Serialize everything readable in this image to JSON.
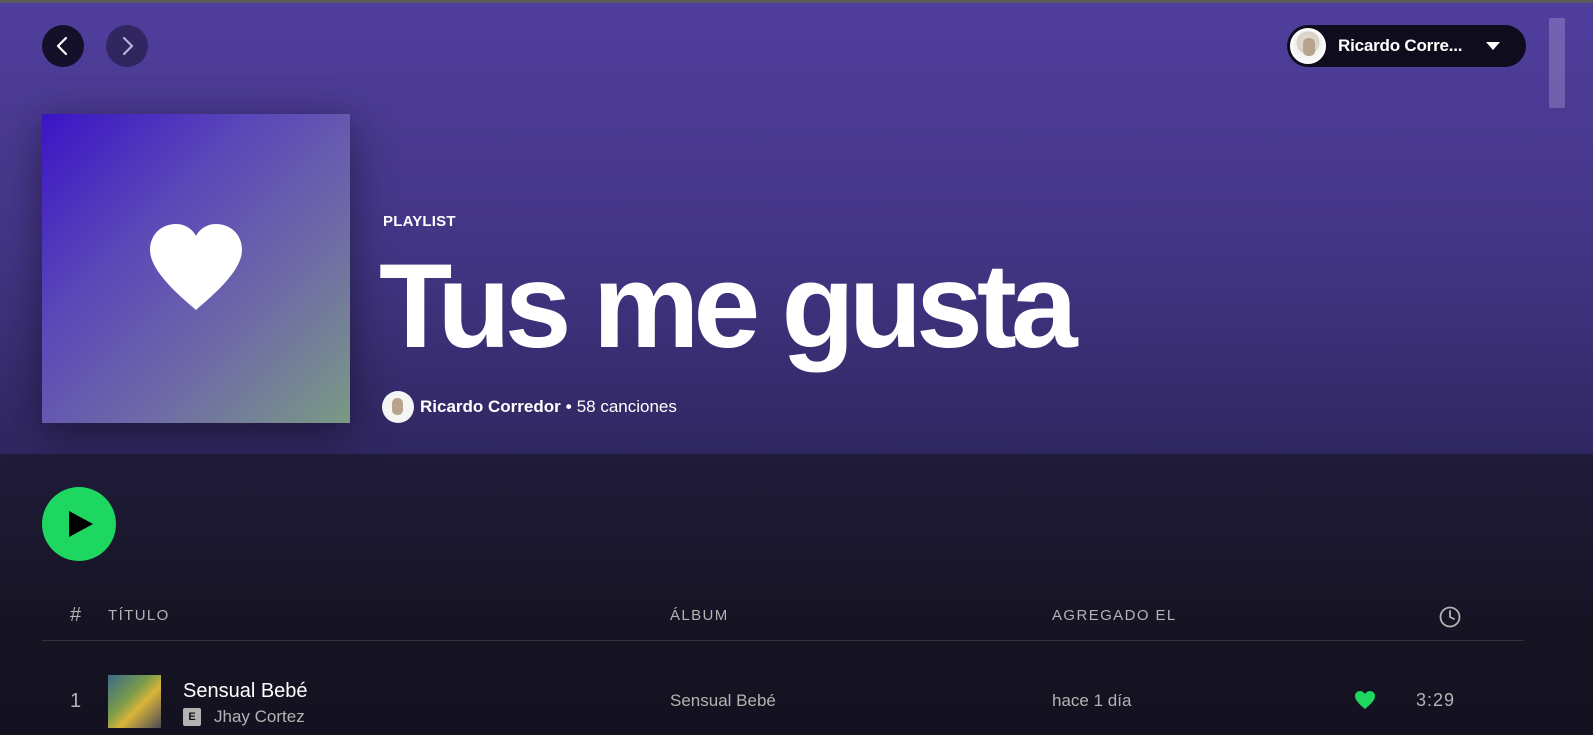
{
  "navigation": {
    "back_icon": "chevron-left-icon",
    "forward_icon": "chevron-right-icon"
  },
  "user": {
    "name": "Ricardo Corre...",
    "menu_icon": "caret-down-icon"
  },
  "playlist": {
    "type_label": "PLAYLIST",
    "title": "Tus me gusta",
    "owner": "Ricardo Corredor",
    "separator": "•",
    "song_count": "58 canciones",
    "cover_icon": "heart-icon",
    "cover_colors": [
      "#3a14c6",
      "#7a9a84"
    ]
  },
  "controls": {
    "play_icon": "play-icon",
    "play_color": "#1ed760"
  },
  "table": {
    "headers": {
      "number": "#",
      "title": "TÍTULO",
      "album": "ÁLBUM",
      "added": "AGREGADO EL",
      "duration_icon": "clock-icon"
    },
    "rows": [
      {
        "number": "1",
        "title": "Sensual Bebé",
        "explicit": "E",
        "artist": "Jhay Cortez",
        "album": "Sensual Bebé",
        "added": "hace 1 día",
        "liked_color": "#1ed760",
        "duration": "3:29"
      }
    ]
  }
}
